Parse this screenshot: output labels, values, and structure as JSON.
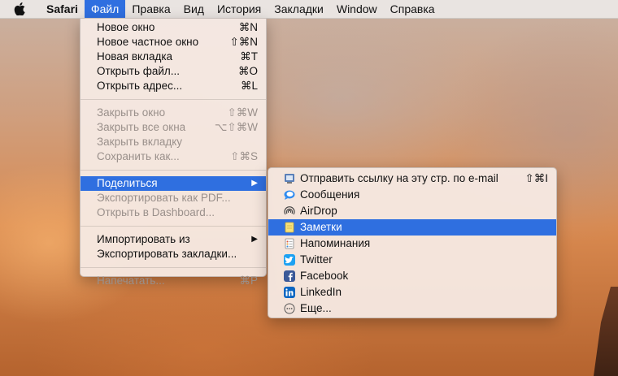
{
  "menubar": {
    "app": "Safari",
    "items": [
      "Файл",
      "Правка",
      "Вид",
      "История",
      "Закладки",
      "Window",
      "Справка"
    ]
  },
  "file_menu": {
    "group1": [
      {
        "label": "Новое окно",
        "shortcut": "⌘N"
      },
      {
        "label": "Новое частное окно",
        "shortcut": "⇧⌘N"
      },
      {
        "label": "Новая вкладка",
        "shortcut": "⌘T"
      },
      {
        "label": "Открыть файл...",
        "shortcut": "⌘O"
      },
      {
        "label": "Открыть адрес...",
        "shortcut": "⌘L"
      }
    ],
    "group2": [
      {
        "label": "Закрыть окно",
        "shortcut": "⇧⌘W"
      },
      {
        "label": "Закрыть все окна",
        "shortcut": "⌥⇧⌘W"
      },
      {
        "label": "Закрыть вкладку",
        "shortcut": ""
      },
      {
        "label": "Сохранить как...",
        "shortcut": "⇧⌘S"
      }
    ],
    "group3": [
      {
        "label": "Поделиться"
      },
      {
        "label": "Экспортировать как PDF..."
      },
      {
        "label": "Открыть в Dashboard..."
      }
    ],
    "group4": [
      {
        "label": "Импортировать из"
      },
      {
        "label": "Экспортировать закладки..."
      }
    ],
    "group5": [
      {
        "label": "Напечатать...",
        "shortcut": "⌘P"
      }
    ]
  },
  "share_menu": {
    "items": [
      {
        "label": "Отправить ссылку на эту стр. по e-mail",
        "shortcut": "⇧⌘I",
        "icon": "mail-icon"
      },
      {
        "label": "Сообщения",
        "icon": "messages-icon"
      },
      {
        "label": "AirDrop",
        "icon": "airdrop-icon"
      },
      {
        "label": "Заметки",
        "icon": "notes-icon"
      },
      {
        "label": "Напоминания",
        "icon": "reminders-icon"
      },
      {
        "label": "Twitter",
        "icon": "twitter-icon"
      },
      {
        "label": "Facebook",
        "icon": "facebook-icon"
      },
      {
        "label": "LinkedIn",
        "icon": "linkedin-icon"
      },
      {
        "label": "Еще...",
        "icon": "more-icon"
      }
    ]
  },
  "colors": {
    "highlight": "#2f6fe0",
    "twitter": "#1da1f2",
    "facebook": "#3b5998",
    "linkedin": "#0a66c2"
  }
}
